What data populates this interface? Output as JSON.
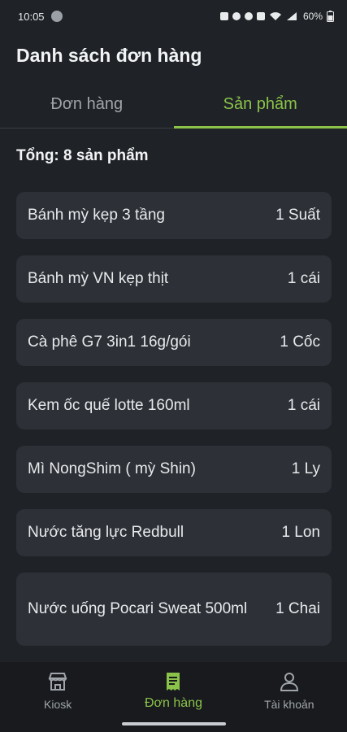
{
  "status_bar": {
    "time": "10:05",
    "battery": "60%"
  },
  "header": {
    "title": "Danh sách đơn hàng"
  },
  "tabs": [
    {
      "label": "Đơn hàng",
      "active": false
    },
    {
      "label": "Sản phẩm",
      "active": true
    }
  ],
  "summary": {
    "total": "Tổng: 8 sản phẩm"
  },
  "products": [
    {
      "name": "Bánh mỳ kẹp 3 tầng",
      "qty": "1 Suất"
    },
    {
      "name": "Bánh mỳ VN kẹp thịt",
      "qty": "1 cái"
    },
    {
      "name": "Cà phê G7 3in1 16g/gói",
      "qty": "1 Cốc"
    },
    {
      "name": "Kem ốc quế lotte 160ml",
      "qty": "1 cái"
    },
    {
      "name": "Mì NongShim ( mỳ Shin)",
      "qty": "1 Ly"
    },
    {
      "name": "Nước tăng lực Redbull",
      "qty": "1 Lon"
    },
    {
      "name": "Nước uống Pocari Sweat 500ml",
      "qty": "1 Chai"
    }
  ],
  "bottom_nav": [
    {
      "label": "Kiosk",
      "icon": "store-icon",
      "active": false
    },
    {
      "label": "Đơn hàng",
      "icon": "receipt-icon",
      "active": true
    },
    {
      "label": "Tài khoản",
      "icon": "person-icon",
      "active": false
    }
  ],
  "colors": {
    "accent": "#8bc34a",
    "background": "#1f2226",
    "card": "#2d3137",
    "nav_background": "#181a1d"
  }
}
